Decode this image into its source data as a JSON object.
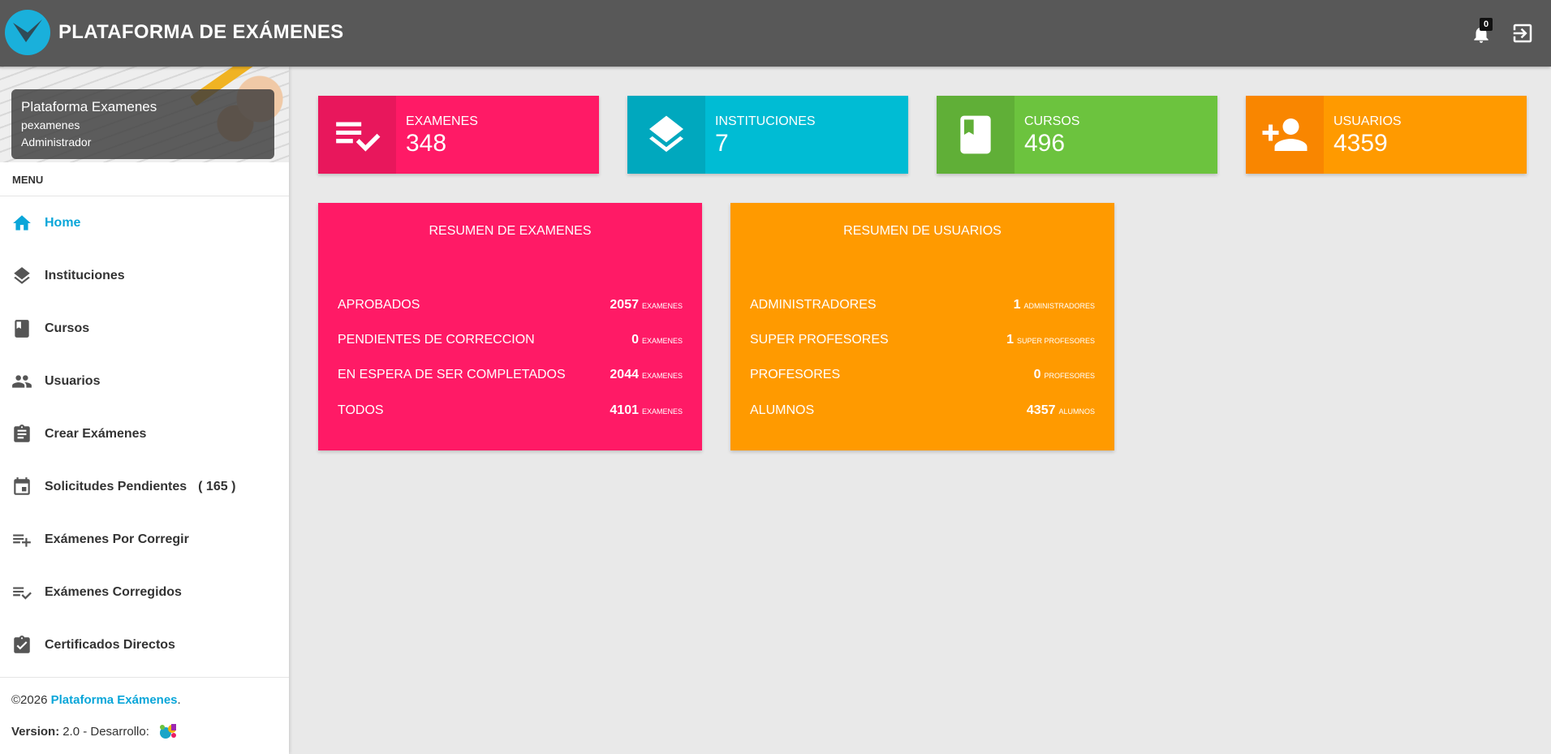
{
  "header": {
    "brand": "PLATAFORMA DE EXÁMENES",
    "notification_count": "0",
    "icons": {
      "logo": "logo-check-icon",
      "notifications": "bell-icon",
      "logout": "logout-icon"
    }
  },
  "user": {
    "name": "Plataforma Examenes",
    "login": "pexamenes",
    "role": "Administrador"
  },
  "sidebar": {
    "menu_header": "MENU",
    "items": [
      {
        "label": "Home",
        "icon": "home-icon",
        "active": true,
        "count": ""
      },
      {
        "label": "Instituciones",
        "icon": "layers-icon",
        "active": false,
        "count": ""
      },
      {
        "label": "Cursos",
        "icon": "book-icon",
        "active": false,
        "count": ""
      },
      {
        "label": "Usuarios",
        "icon": "people-icon",
        "active": false,
        "count": ""
      },
      {
        "label": "Crear Exámenes",
        "icon": "assignment-icon",
        "active": false,
        "count": ""
      },
      {
        "label": "Solicitudes Pendientes",
        "icon": "calendar-icon",
        "active": false,
        "count": "( 165 )"
      },
      {
        "label": "Exámenes Por Corregir",
        "icon": "playlist-add-icon",
        "active": false,
        "count": ""
      },
      {
        "label": "Exámenes Corregidos",
        "icon": "playlist-check-icon",
        "active": false,
        "count": ""
      },
      {
        "label": "Certificados Directos",
        "icon": "assignment-check-icon",
        "active": false,
        "count": ""
      }
    ]
  },
  "footer": {
    "copyright_prefix": "©2026 ",
    "copyright_link": "Plataforma Exámenes",
    "copyright_suffix": ".",
    "version_label": "Version:",
    "version_text": "2.0 - Desarrollo:"
  },
  "info_boxes": [
    {
      "label": "EXAMENES",
      "value": "348",
      "icon": "playlist-check-icon",
      "color": "#ff1a66",
      "icon_bg": "#e8175c"
    },
    {
      "label": "INSTITUCIONES",
      "value": "7",
      "icon": "layers-icon",
      "color": "#00bcd4",
      "icon_bg": "#00a8be"
    },
    {
      "label": "CURSOS",
      "value": "496",
      "icon": "book-icon",
      "color": "#6cc33e",
      "icon_bg": "#60af37"
    },
    {
      "label": "USUARIOS",
      "value": "4359",
      "icon": "person-add-icon",
      "color": "#ff9a00",
      "icon_bg": "#f98600"
    }
  ],
  "summary_exams": {
    "title": "RESUMEN DE EXAMENES",
    "color": "#ff1a66",
    "rows": [
      {
        "label": "APROBADOS",
        "value": "2057",
        "unit": "EXAMENES"
      },
      {
        "label": "PENDIENTES DE CORRECCION",
        "value": "0",
        "unit": "EXAMENES"
      },
      {
        "label": "EN ESPERA DE SER COMPLETADOS",
        "value": "2044",
        "unit": "EXAMENES"
      },
      {
        "label": "TODOS",
        "value": "4101",
        "unit": "EXAMENES"
      }
    ]
  },
  "summary_users": {
    "title": "RESUMEN DE USUARIOS",
    "color": "#ff9a00",
    "rows": [
      {
        "label": "ADMINISTRADORES",
        "value": "1",
        "unit": "ADMINISTRADORES"
      },
      {
        "label": "SUPER PROFESORES",
        "value": "1",
        "unit": "SUPER PROFESORES"
      },
      {
        "label": "PROFESORES",
        "value": "0",
        "unit": "PROFESORES"
      },
      {
        "label": "ALUMNOS",
        "value": "4357",
        "unit": "ALUMNOS"
      }
    ]
  }
}
